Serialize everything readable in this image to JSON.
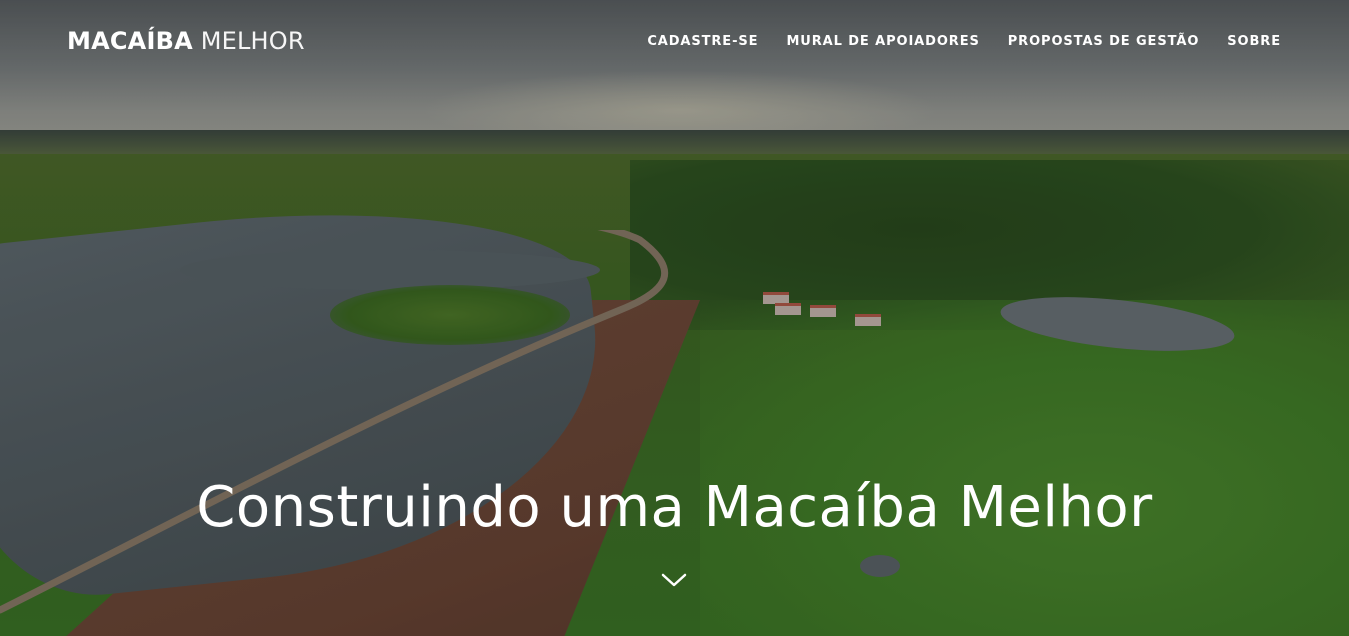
{
  "brand": {
    "strong": "MACAÍBA",
    "light": "MELHOR"
  },
  "nav": {
    "items": [
      {
        "label": "CADASTRE-SE"
      },
      {
        "label": "MURAL DE APOIADORES"
      },
      {
        "label": "PROPOSTAS DE GESTÃO"
      },
      {
        "label": "SOBRE"
      }
    ]
  },
  "hero": {
    "headline": "Construindo uma Macaíba Melhor",
    "scroll_icon": "chevron-down-icon"
  },
  "colors": {
    "text": "#ffffff",
    "water": "#545e63",
    "vegetation": "#3d7128",
    "earth": "#6a4535"
  }
}
